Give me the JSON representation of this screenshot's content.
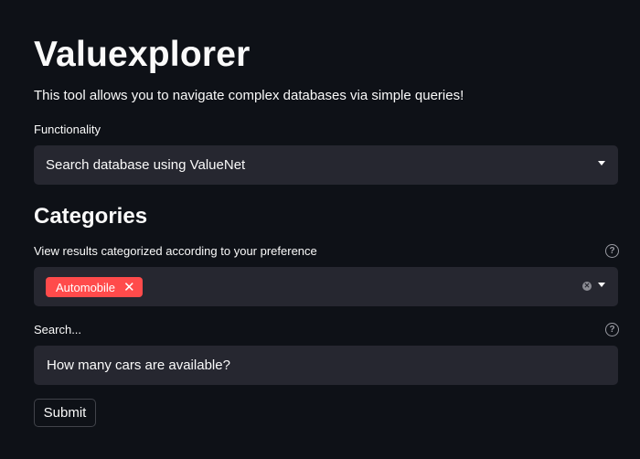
{
  "header": {
    "title": "Valuexplorer",
    "description": "This tool allows you to navigate complex databases via simple queries!"
  },
  "functionality": {
    "label": "Functionality",
    "selected": "Search database using ValueNet"
  },
  "categories": {
    "heading": "Categories",
    "label": "View results categorized according to your preference",
    "selected_tags": [
      "Automobile"
    ],
    "help_icon": "question-circle-icon",
    "clear_icon": "clear-circle-icon"
  },
  "search": {
    "label": "Search...",
    "value": "How many cars are available?",
    "help_icon": "question-circle-icon"
  },
  "submit": {
    "label": "Submit"
  },
  "colors": {
    "background": "#0e1117",
    "input_background": "#262730",
    "tag": "#ff4b4b",
    "text": "#fafafa"
  }
}
